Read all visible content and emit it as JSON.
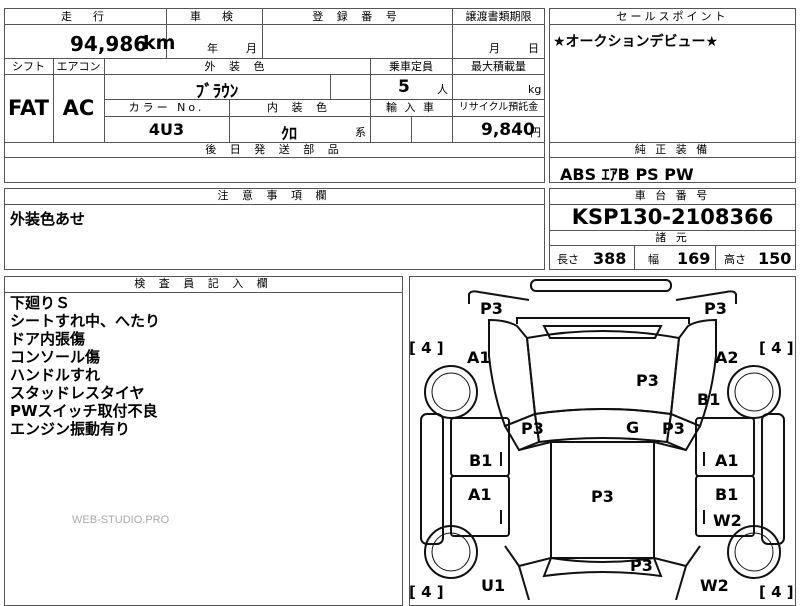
{
  "main_table": {
    "headers": {
      "mileage": "走　行",
      "inspection": "車　検",
      "registration": "登 録 番 号",
      "transfer_deadline": "譲渡書類期限",
      "shift": "シフト",
      "aircon": "エアコン",
      "exterior_color": "外 装 色",
      "seating": "乗車定員",
      "max_load": "最大積載量",
      "color_no": "カラー No.",
      "interior_color": "内 装 色",
      "import": "輸 入 車",
      "recycle": "リサイクル預託金",
      "later_parts": "後 日 発 送 部 品"
    },
    "values": {
      "mileage": "94,986",
      "mileage_unit": "km",
      "inspection_year": "年",
      "inspection_month": "月",
      "transfer_month": "月",
      "transfer_day": "日",
      "shift": "FAT",
      "aircon": "AC",
      "exterior_color": "ﾌﾞﾗｳﾝ",
      "seating": "5",
      "seating_unit": "人",
      "max_load_unit": "kg",
      "color_no": "4U3",
      "interior_color": "ｸﾛ",
      "interior_suffix": "系",
      "recycle": "9,840",
      "recycle_unit": "円"
    }
  },
  "sales_point": {
    "header": "セールスポイント",
    "text": "★オークションデビュー★"
  },
  "equipment": {
    "header": "純 正 装 備",
    "text": "ABS ｴｱB PS PW"
  },
  "caution": {
    "header": "注 意 事 項 欄",
    "text": "外装色あせ"
  },
  "chassis": {
    "header": "車 台 番 号",
    "number": "KSP130-2108366",
    "spec_header": "諸 元",
    "length_label": "長さ",
    "length": "388",
    "width_label": "幅",
    "width": "169",
    "height_label": "高さ",
    "height": "150"
  },
  "inspector": {
    "header": "検 査 員 記 入 欄",
    "notes": [
      "下廻りＳ",
      "シートすれ中、へたり",
      "ドア内張傷",
      "コンソール傷",
      "ハンドルすれ",
      "スタッドレスタイヤ",
      "PWスイッチ取付不良",
      "エンジン振動有り"
    ],
    "watermark": "WEB-STUDIO.PRO"
  },
  "diagram": {
    "marks": {
      "p3_top_left": "P3",
      "p3_top_right": "P3",
      "a1_front_left": "A1",
      "a2_front_right": "A2",
      "p3_hood": "P3",
      "b1_right_fender": "B1",
      "p3_left_pillar": "P3",
      "g_windshield": "G",
      "p3_right_pillar": "P3",
      "b1_left_door": "B1",
      "a1_right_door": "A1",
      "a1_left_rear_door": "A1",
      "p3_roof": "P3",
      "b1_right_rear_door": "B1",
      "w2_right_rear_door": "W2",
      "p3_trunk": "P3",
      "u1_rear_left": "U1",
      "w2_rear_right": "W2"
    },
    "tires": {
      "front_left": "4",
      "front_right": "4",
      "rear_left": "4",
      "rear_right": "4"
    }
  }
}
